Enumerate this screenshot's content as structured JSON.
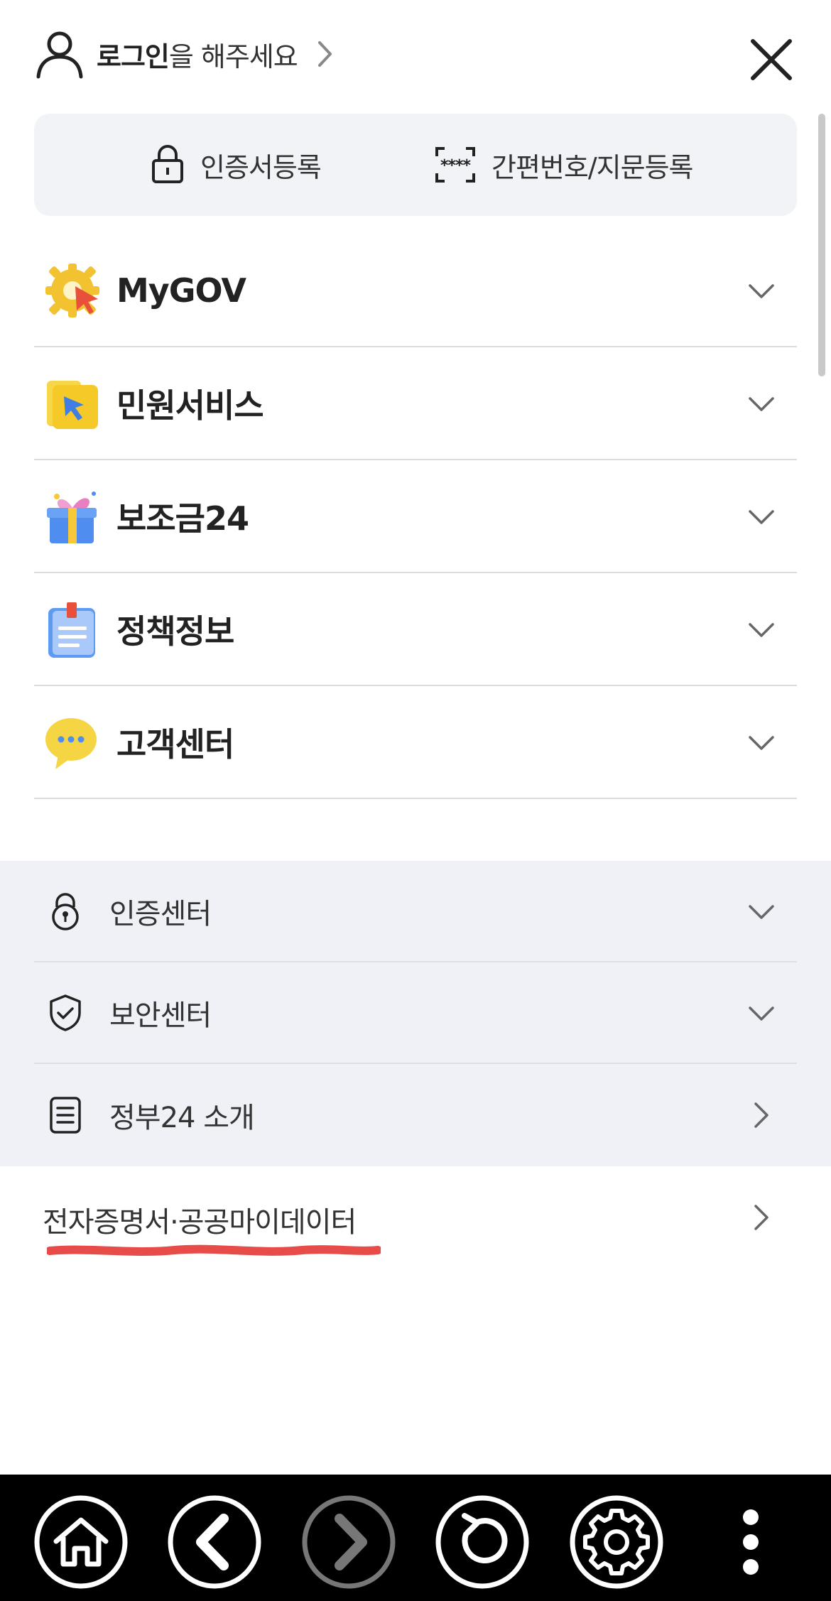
{
  "header": {
    "login_bold": "로그인",
    "login_rest": "을 해주세요"
  },
  "quick_actions": [
    {
      "label": "인증서등록",
      "icon": "lock-icon"
    },
    {
      "label": "간편번호/지문등록",
      "icon": "pin-scan-icon"
    }
  ],
  "menu": {
    "items": [
      {
        "label": "MyGOV",
        "icon": "mygov-gear-icon"
      },
      {
        "label": "민원서비스",
        "icon": "folder-cursor-icon"
      },
      {
        "label": "보조금24",
        "icon": "gift-box-icon"
      },
      {
        "label": "정책정보",
        "icon": "clipboard-doc-icon"
      },
      {
        "label": "고객센터",
        "icon": "speech-bubble-icon"
      }
    ]
  },
  "sub_menu": {
    "items": [
      {
        "label": "인증센터",
        "icon": "padlock-icon",
        "indicator": "chevron-down"
      },
      {
        "label": "보안센터",
        "icon": "shield-check-icon",
        "indicator": "chevron-down"
      },
      {
        "label": "정부24 소개",
        "icon": "document-list-icon",
        "indicator": "chevron-right"
      }
    ]
  },
  "ecert": {
    "label": "전자증명서·공공마이데이터",
    "underline_color": "#e53935"
  },
  "bottom_nav": {
    "items": [
      {
        "icon": "home-icon",
        "enabled": true
      },
      {
        "icon": "back-icon",
        "enabled": true
      },
      {
        "icon": "forward-icon",
        "enabled": false
      },
      {
        "icon": "refresh-icon",
        "enabled": true
      },
      {
        "icon": "settings-icon",
        "enabled": true
      },
      {
        "icon": "more-vertical-icon",
        "enabled": true
      }
    ]
  },
  "colors": {
    "quick_box_bg": "#f1f3f7",
    "sub_section_bg": "#eff1f6",
    "bottom_bar_bg": "#000000"
  }
}
